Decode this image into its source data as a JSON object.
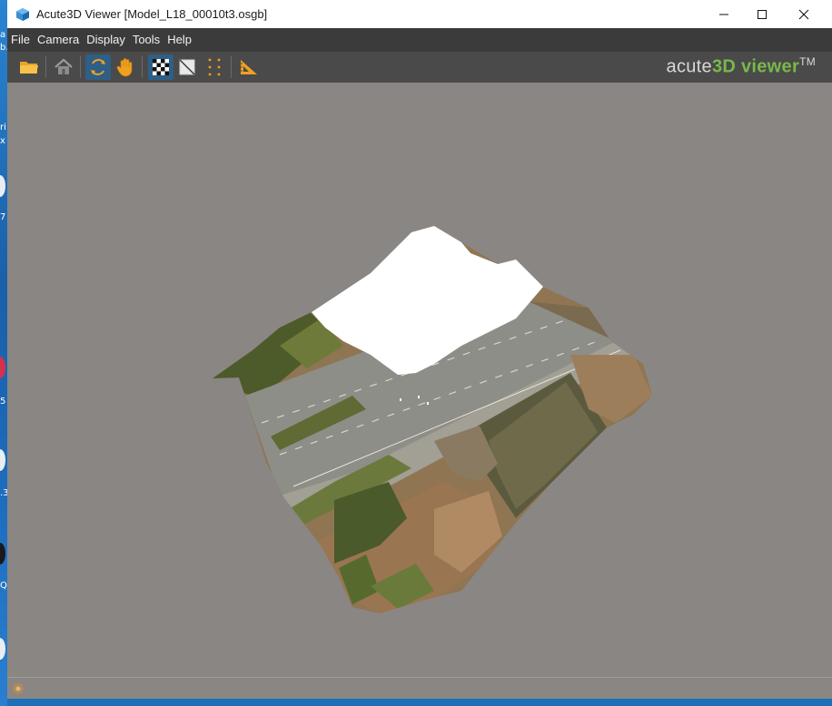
{
  "window": {
    "title": "Acute3D Viewer [Model_L18_00010t3.osgb]"
  },
  "menu": [
    "File",
    "Camera",
    "Display",
    "Tools",
    "Help"
  ],
  "toolbar": {
    "buttons": [
      {
        "name": "open-folder",
        "icon": "folder-icon",
        "active": false
      },
      {
        "name": "home-view",
        "icon": "home-icon",
        "active": false
      },
      {
        "name": "orbit",
        "icon": "orbit-icon",
        "active": true
      },
      {
        "name": "pan",
        "icon": "hand-icon",
        "active": false
      },
      {
        "name": "textured",
        "icon": "checker-icon",
        "active": true
      },
      {
        "name": "shaded",
        "icon": "shaded-square-icon",
        "active": false
      },
      {
        "name": "point-cloud",
        "icon": "dots-icon",
        "active": false
      },
      {
        "name": "measure",
        "icon": "ruler-triangle-icon",
        "active": false
      }
    ]
  },
  "brand": {
    "prefix": "acute",
    "bold": "3D",
    "suffix": " viewer",
    "mark": "TM"
  },
  "colors": {
    "menubar": "#3b3b3b",
    "toolbar": "#4a4a4a",
    "viewport": "#8a8684",
    "accent_active": "#2e5f86",
    "brand_green": "#79b84a",
    "icon_orange": "#f0a020"
  },
  "desktop_fragments": [
    "a",
    "b.",
    "ri",
    "x",
    "7",
    "5",
    ".3",
    "Q"
  ]
}
